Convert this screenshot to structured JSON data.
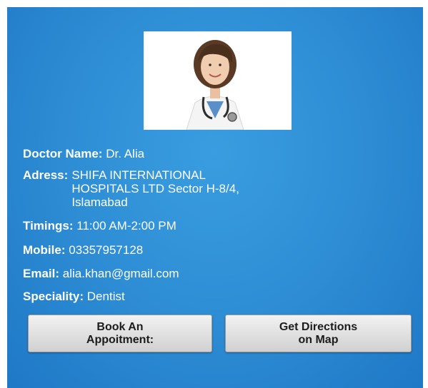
{
  "doctor": {
    "name_label": "Doctor Name:",
    "name": "Dr. Alia",
    "address_label": "Adress:",
    "address": "SHIFA INTERNATIONAL\nHOSPITALS LTD Sector H-8/4,\nIslamabad",
    "timings_label": "Timings:",
    "timings": "11:00 AM-2:00 PM",
    "mobile_label": "Mobile:",
    "mobile": "03357957128",
    "email_label": "Email:",
    "email": "alia.khan@gmail.com",
    "speciality_label": "Speciality:",
    "speciality": "Dentist"
  },
  "buttons": {
    "book": "Book An\nAppoitment:",
    "directions": "Get Directions\non Map"
  },
  "colors": {
    "background": "#2f8fd6",
    "text": "#ffffff",
    "button_bg": "#e2e2e2"
  },
  "icons": {
    "profile": "doctor-photo"
  }
}
